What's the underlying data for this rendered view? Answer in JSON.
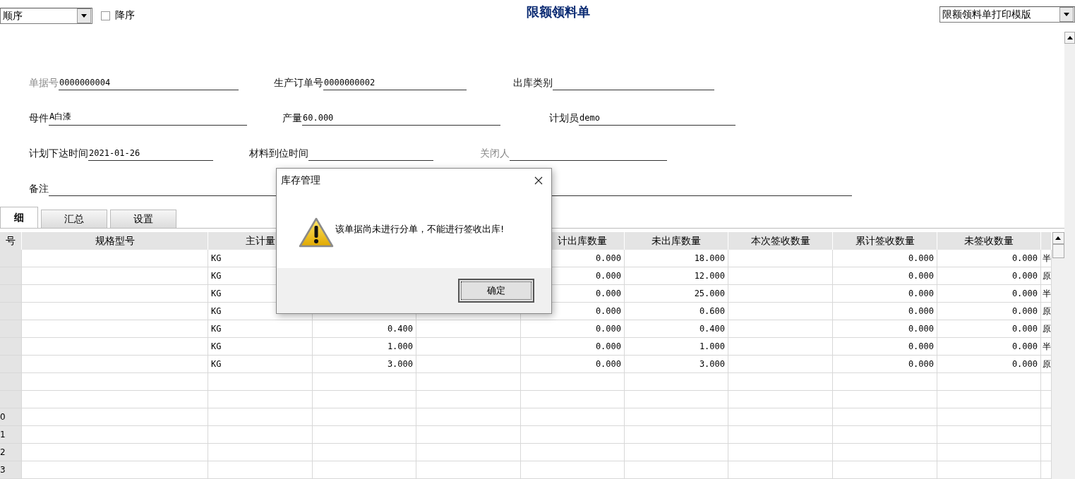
{
  "sort": {
    "value": "顺序",
    "descending": {
      "label": "降序",
      "checked": false
    }
  },
  "title": "限额领料单",
  "template": {
    "value": "限额领料单打印模版"
  },
  "form": {
    "rows": [
      [
        {
          "label": "单据号",
          "value": "0000000004",
          "muted": true
        },
        {
          "label": "生产订单号",
          "value": "0000000002",
          "muted": false
        },
        {
          "label": "出库类别",
          "muted": false
        }
      ],
      [
        {
          "label": "母件",
          "value": "A白漆",
          "muted": false
        },
        {
          "label": "产量",
          "value": "60.000",
          "muted": false
        },
        {
          "label": "计划员",
          "value": "demo",
          "muted": false
        }
      ],
      [
        {
          "label": "计划下达时间",
          "value": "2021-01-26",
          "muted": false
        },
        {
          "label": "材料到位时间",
          "muted": false
        },
        {
          "label": "关闭人",
          "muted": true
        }
      ],
      [
        {
          "label": "备注",
          "muted": false
        }
      ]
    ]
  },
  "tabs": [
    {
      "label": "细",
      "selected": true
    },
    {
      "label": "汇总",
      "selected": false
    },
    {
      "label": "设置",
      "selected": false
    }
  ],
  "table": {
    "columns": [
      "号",
      "规格型号",
      "主计量",
      null,
      null,
      "计出库数量",
      "未出库数量",
      "本次签收数量",
      "累计签收数量",
      "未签收数量",
      null
    ],
    "rows": [
      {
        "cells": [
          null,
          "KG",
          null,
          null,
          "0.000",
          "18.000",
          null,
          "0.000",
          "0.000",
          "半"
        ]
      },
      {
        "cells": [
          null,
          "KG",
          null,
          null,
          "0.000",
          "12.000",
          null,
          "0.000",
          "0.000",
          "原"
        ]
      },
      {
        "cells": [
          null,
          "KG",
          null,
          null,
          "0.000",
          "25.000",
          null,
          "0.000",
          "0.000",
          "半"
        ]
      },
      {
        "cells": [
          null,
          "KG",
          null,
          null,
          "0.000",
          "0.600",
          null,
          "0.000",
          "0.000",
          "原"
        ]
      },
      {
        "cells": [
          null,
          "KG",
          "0.400",
          null,
          "0.000",
          "0.400",
          null,
          "0.000",
          "0.000",
          "原"
        ]
      },
      {
        "cells": [
          null,
          "KG",
          "1.000",
          null,
          "0.000",
          "1.000",
          null,
          "0.000",
          "0.000",
          "半"
        ]
      },
      {
        "cells": [
          null,
          "KG",
          "3.000",
          null,
          "0.000",
          "3.000",
          null,
          "0.000",
          "0.000",
          "原"
        ]
      },
      {},
      {},
      {
        "number": "0"
      },
      {
        "number": "1"
      },
      {
        "number": "2"
      },
      {
        "number": "3"
      }
    ]
  },
  "dialog": {
    "title": "库存管理",
    "message": "该单据尚未进行分单，不能进行签收出库!",
    "button": "确定"
  }
}
